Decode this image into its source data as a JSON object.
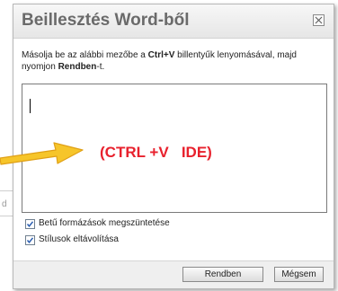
{
  "dialog": {
    "title": "Beillesztés Word-ből",
    "instruction_prefix": "Másolja be az alábbi mezőbe a ",
    "instruction_key": "Ctrl+V",
    "instruction_middle": " billentyűk lenyomásával, majd nyomjon ",
    "instruction_button": "Rendben",
    "instruction_suffix": "-t.",
    "annotation": "(CTRL +V   IDE)",
    "options": [
      {
        "label": "Betű formázások megszüntetése",
        "checked": true
      },
      {
        "label": "Stílusok eltávolítása",
        "checked": true
      }
    ],
    "ok_label": "Rendben",
    "cancel_label": "Mégsem",
    "close_icon": "close-icon"
  },
  "background": {
    "fragment_char": "d"
  },
  "colors": {
    "annotation": "#e8212d",
    "arrow_fill": "#f6c52a",
    "arrow_stroke": "#e0a016"
  }
}
